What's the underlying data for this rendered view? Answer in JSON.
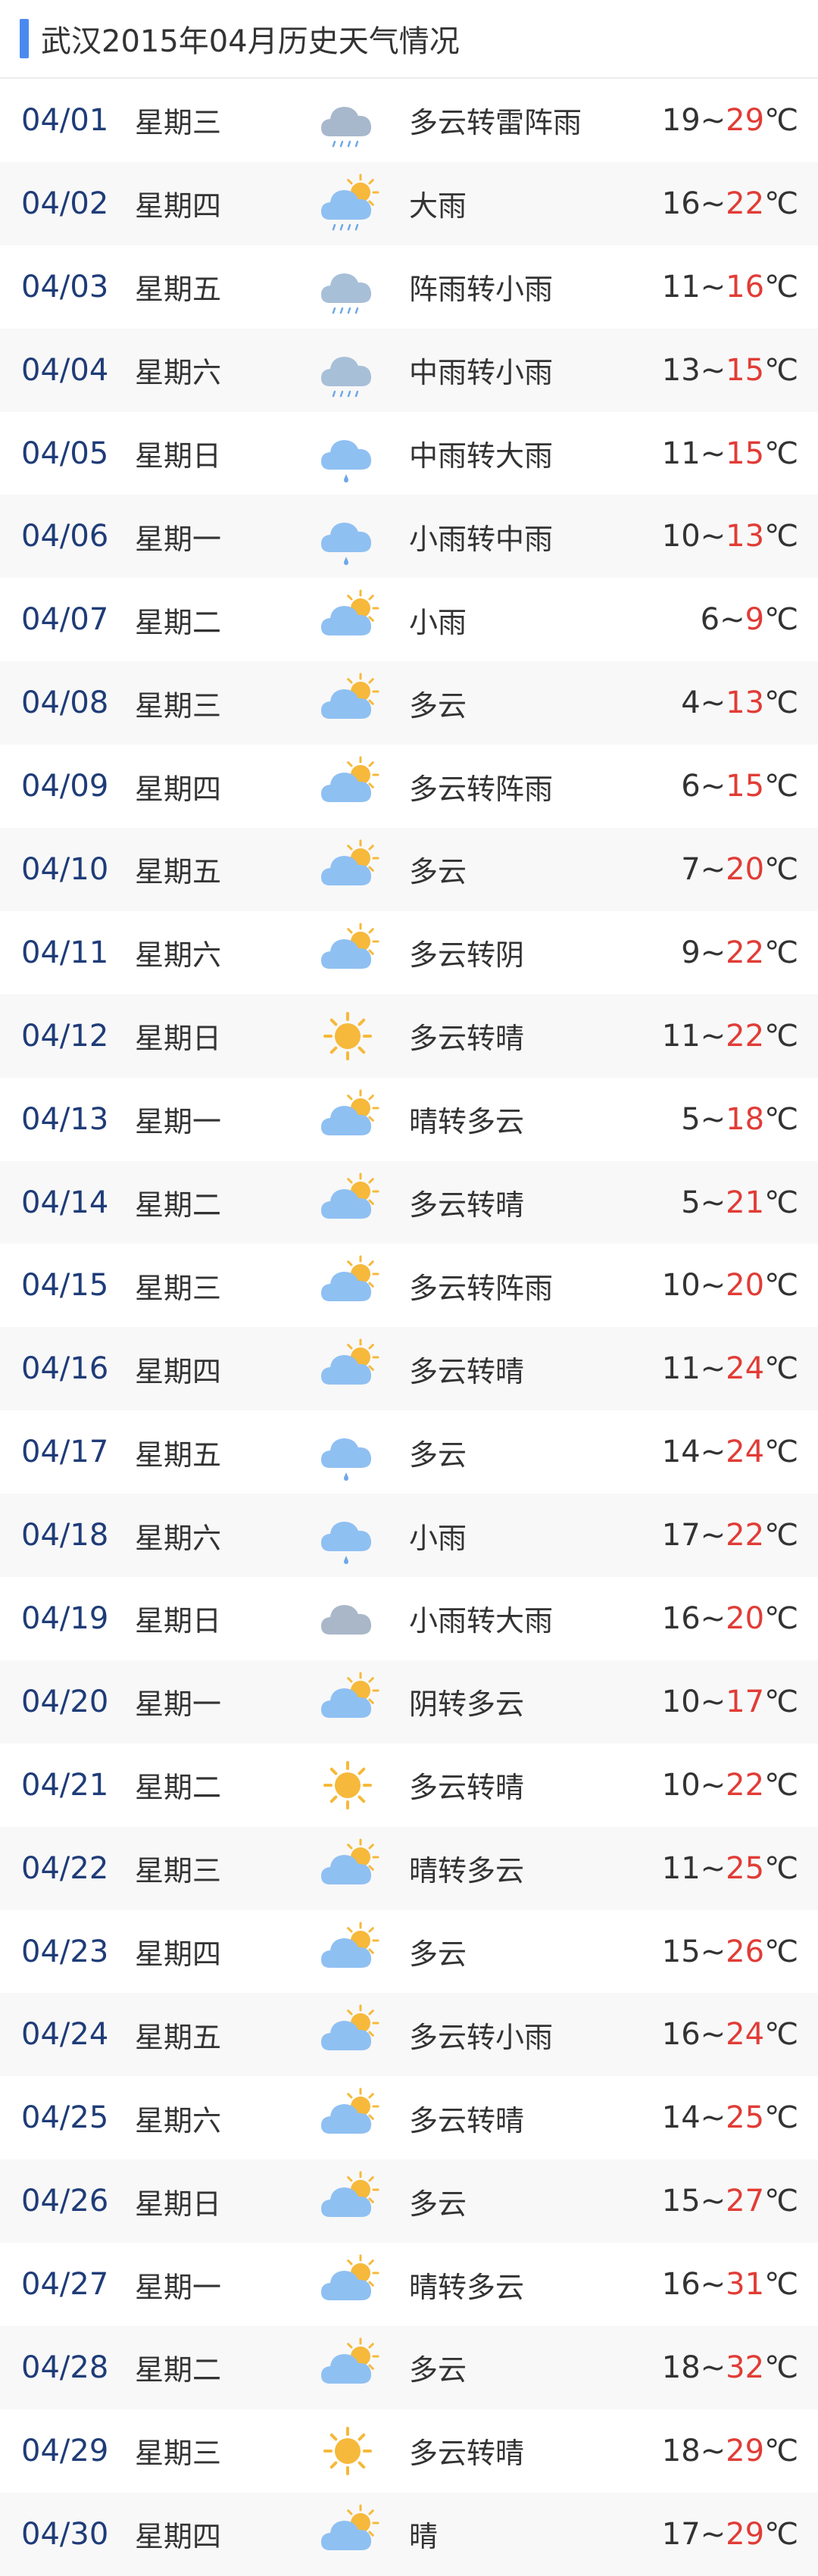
{
  "header": {
    "title": "武汉2015年04月历史天气情况"
  },
  "colors": {
    "accent_bar": "#4a8af0",
    "date_text": "#1f3c78",
    "high_temp": "#e13c36"
  },
  "days": [
    {
      "date": "04/01",
      "weekday": "星期三",
      "icon": "thunder-rain-icon",
      "desc": "多云转雷阵雨",
      "low": "19",
      "high": "29",
      "unit": "℃"
    },
    {
      "date": "04/02",
      "weekday": "星期四",
      "icon": "sun-cloud-rain-icon",
      "desc": "大雨",
      "low": "16",
      "high": "22",
      "unit": "℃"
    },
    {
      "date": "04/03",
      "weekday": "星期五",
      "icon": "shower-icon",
      "desc": "阵雨转小雨",
      "low": "11",
      "high": "16",
      "unit": "℃"
    },
    {
      "date": "04/04",
      "weekday": "星期六",
      "icon": "moderate-rain-icon",
      "desc": "中雨转小雨",
      "low": "13",
      "high": "15",
      "unit": "℃"
    },
    {
      "date": "04/05",
      "weekday": "星期日",
      "icon": "light-rain-icon",
      "desc": "中雨转大雨",
      "low": "11",
      "high": "15",
      "unit": "℃"
    },
    {
      "date": "04/06",
      "weekday": "星期一",
      "icon": "light-rain-icon",
      "desc": "小雨转中雨",
      "low": "10",
      "high": "13",
      "unit": "℃"
    },
    {
      "date": "04/07",
      "weekday": "星期二",
      "icon": "partly-cloudy-icon",
      "desc": "小雨",
      "low": "6",
      "high": "9",
      "unit": "℃"
    },
    {
      "date": "04/08",
      "weekday": "星期三",
      "icon": "partly-cloudy-icon",
      "desc": "多云",
      "low": "4",
      "high": "13",
      "unit": "℃"
    },
    {
      "date": "04/09",
      "weekday": "星期四",
      "icon": "partly-cloudy-icon",
      "desc": "多云转阵雨",
      "low": "6",
      "high": "15",
      "unit": "℃"
    },
    {
      "date": "04/10",
      "weekday": "星期五",
      "icon": "partly-cloudy-icon",
      "desc": "多云",
      "low": "7",
      "high": "20",
      "unit": "℃"
    },
    {
      "date": "04/11",
      "weekday": "星期六",
      "icon": "partly-cloudy-icon",
      "desc": "多云转阴",
      "low": "9",
      "high": "22",
      "unit": "℃"
    },
    {
      "date": "04/12",
      "weekday": "星期日",
      "icon": "sunny-icon",
      "desc": "多云转晴",
      "low": "11",
      "high": "22",
      "unit": "℃"
    },
    {
      "date": "04/13",
      "weekday": "星期一",
      "icon": "partly-cloudy-icon",
      "desc": "晴转多云",
      "low": "5",
      "high": "18",
      "unit": "℃"
    },
    {
      "date": "04/14",
      "weekday": "星期二",
      "icon": "partly-cloudy-icon",
      "desc": "多云转晴",
      "low": "5",
      "high": "21",
      "unit": "℃"
    },
    {
      "date": "04/15",
      "weekday": "星期三",
      "icon": "partly-cloudy-icon",
      "desc": "多云转阵雨",
      "low": "10",
      "high": "20",
      "unit": "℃"
    },
    {
      "date": "04/16",
      "weekday": "星期四",
      "icon": "partly-cloudy-icon",
      "desc": "多云转晴",
      "low": "11",
      "high": "24",
      "unit": "℃"
    },
    {
      "date": "04/17",
      "weekday": "星期五",
      "icon": "light-rain-icon",
      "desc": "多云",
      "low": "14",
      "high": "24",
      "unit": "℃"
    },
    {
      "date": "04/18",
      "weekday": "星期六",
      "icon": "light-rain-icon",
      "desc": "小雨",
      "low": "17",
      "high": "22",
      "unit": "℃"
    },
    {
      "date": "04/19",
      "weekday": "星期日",
      "icon": "overcast-icon",
      "desc": "小雨转大雨",
      "low": "16",
      "high": "20",
      "unit": "℃"
    },
    {
      "date": "04/20",
      "weekday": "星期一",
      "icon": "partly-cloudy-icon",
      "desc": "阴转多云",
      "low": "10",
      "high": "17",
      "unit": "℃"
    },
    {
      "date": "04/21",
      "weekday": "星期二",
      "icon": "sunny-icon",
      "desc": "多云转晴",
      "low": "10",
      "high": "22",
      "unit": "℃"
    },
    {
      "date": "04/22",
      "weekday": "星期三",
      "icon": "partly-cloudy-icon",
      "desc": "晴转多云",
      "low": "11",
      "high": "25",
      "unit": "℃"
    },
    {
      "date": "04/23",
      "weekday": "星期四",
      "icon": "partly-cloudy-icon",
      "desc": "多云",
      "low": "15",
      "high": "26",
      "unit": "℃"
    },
    {
      "date": "04/24",
      "weekday": "星期五",
      "icon": "partly-cloudy-icon",
      "desc": "多云转小雨",
      "low": "16",
      "high": "24",
      "unit": "℃"
    },
    {
      "date": "04/25",
      "weekday": "星期六",
      "icon": "partly-cloudy-icon",
      "desc": "多云转晴",
      "low": "14",
      "high": "25",
      "unit": "℃"
    },
    {
      "date": "04/26",
      "weekday": "星期日",
      "icon": "partly-cloudy-icon",
      "desc": "多云",
      "low": "15",
      "high": "27",
      "unit": "℃"
    },
    {
      "date": "04/27",
      "weekday": "星期一",
      "icon": "partly-cloudy-icon",
      "desc": "晴转多云",
      "low": "16",
      "high": "31",
      "unit": "℃"
    },
    {
      "date": "04/28",
      "weekday": "星期二",
      "icon": "partly-cloudy-icon",
      "desc": "多云",
      "low": "18",
      "high": "32",
      "unit": "℃"
    },
    {
      "date": "04/29",
      "weekday": "星期三",
      "icon": "sunny-icon",
      "desc": "多云转晴",
      "low": "18",
      "high": "29",
      "unit": "℃"
    },
    {
      "date": "04/30",
      "weekday": "星期四",
      "icon": "partly-cloudy-icon",
      "desc": "晴",
      "low": "17",
      "high": "29",
      "unit": "℃"
    }
  ]
}
